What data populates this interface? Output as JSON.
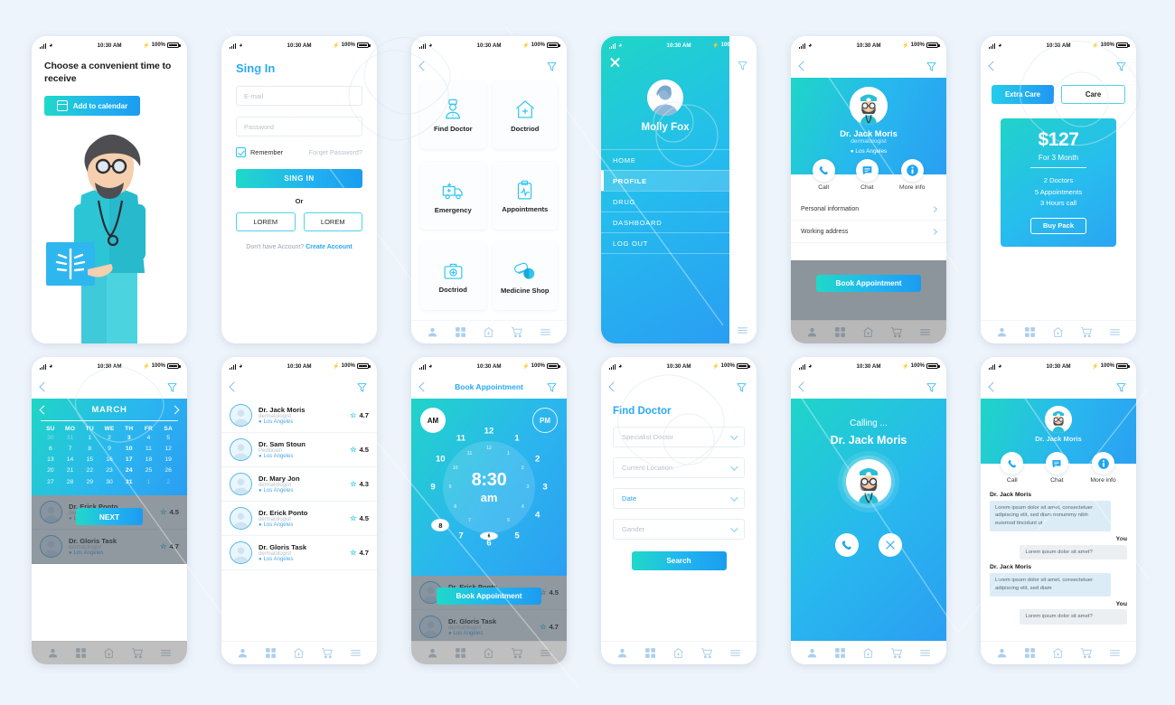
{
  "status_bar": {
    "time": "10:30 AM",
    "battery": "100%"
  },
  "tabbar": {
    "icons": [
      "person-icon",
      "grid-icon",
      "hospital-icon",
      "cart-icon",
      "menu-icon"
    ]
  },
  "screens": {
    "s1_calendar_intro": {
      "title": "Choose a convenient time to receive",
      "add_button": "Add to calendar",
      "icon": "calendar-icon",
      "illustration": "doctor-with-xray-illustration"
    },
    "s2_signin": {
      "title": "Sing In",
      "email_placeholder": "E-mail",
      "password_placeholder": "Password",
      "remember_label": "Remember",
      "forgot_label": "Forget Password?",
      "submit_label": "SING IN",
      "or_label": "Or",
      "social_left": "LOREM",
      "social_right": "LOREM",
      "no_account_text": "Don't have Account?",
      "create_account": "Create Account"
    },
    "s3_menu": {
      "items": [
        {
          "label": "Find Doctor",
          "icon": "doctor-icon"
        },
        {
          "label": "Doctriod",
          "icon": "hospital-home-icon"
        },
        {
          "label": "Emergency",
          "icon": "ambulance-icon"
        },
        {
          "label": "Appointments",
          "icon": "clipboard-pulse-icon"
        },
        {
          "label": "Doctriod",
          "icon": "first-aid-kit-icon"
        },
        {
          "label": "Medicine Shop",
          "icon": "pills-icon"
        }
      ]
    },
    "s4_drawer": {
      "user_name": "Molly Fox",
      "close_icon": "close-icon",
      "items": [
        "HOME",
        "PROFILE",
        "DRUG",
        "DASHBOARD",
        "LOG OUT"
      ],
      "active_item": "PROFILE"
    },
    "s5_profile": {
      "doctor_name": "Dr. Jack Moris",
      "specialty": "dermatologist",
      "location": "Los Angeles",
      "actions": [
        {
          "label": "Call",
          "icon": "phone-icon"
        },
        {
          "label": "Chat",
          "icon": "chat-icon"
        },
        {
          "label": "More info",
          "icon": "info-icon"
        }
      ],
      "rows": [
        "Personal information",
        "Working address"
      ],
      "cta": "Book Appointment"
    },
    "s6_pricing": {
      "tab_active": "Extra Care",
      "tab_inactive": "Care",
      "price": "$127",
      "period": "For 3 Month",
      "features": [
        "2 Doctors",
        "5 Appointments",
        "3 Hours call"
      ],
      "buy_label": "Buy Pack"
    },
    "s7_calendar": {
      "month": "MARCH",
      "dow": [
        "SU",
        "MO",
        "TU",
        "WE",
        "TH",
        "FR",
        "SA"
      ],
      "weeks": [
        [
          {
            "d": "30",
            "s": "mut"
          },
          {
            "d": "31",
            "s": "mut"
          },
          {
            "d": "1",
            "s": ""
          },
          {
            "d": "2",
            "s": ""
          },
          {
            "d": "3",
            "s": "hi"
          },
          {
            "d": "4",
            "s": ""
          },
          {
            "d": "5",
            "s": ""
          }
        ],
        [
          {
            "d": "6",
            "s": ""
          },
          {
            "d": "7",
            "s": ""
          },
          {
            "d": "8",
            "s": ""
          },
          {
            "d": "9",
            "s": ""
          },
          {
            "d": "10",
            "s": "hi"
          },
          {
            "d": "11",
            "s": ""
          },
          {
            "d": "12",
            "s": ""
          }
        ],
        [
          {
            "d": "13",
            "s": ""
          },
          {
            "d": "14",
            "s": ""
          },
          {
            "d": "15",
            "s": ""
          },
          {
            "d": "16",
            "s": ""
          },
          {
            "d": "17",
            "s": "hi"
          },
          {
            "d": "18",
            "s": ""
          },
          {
            "d": "19",
            "s": ""
          }
        ],
        [
          {
            "d": "20",
            "s": ""
          },
          {
            "d": "21",
            "s": ""
          },
          {
            "d": "22",
            "s": ""
          },
          {
            "d": "23",
            "s": ""
          },
          {
            "d": "24",
            "s": "hi"
          },
          {
            "d": "25",
            "s": ""
          },
          {
            "d": "26",
            "s": ""
          }
        ],
        [
          {
            "d": "27",
            "s": ""
          },
          {
            "d": "28",
            "s": ""
          },
          {
            "d": "29",
            "s": ""
          },
          {
            "d": "30",
            "s": ""
          },
          {
            "d": "31",
            "s": "hi"
          },
          {
            "d": "1",
            "s": "mut"
          },
          {
            "d": "2",
            "s": "mut"
          }
        ]
      ],
      "next_label": "NEXT",
      "doctors": [
        {
          "name": "Dr. Erick Ponto",
          "specialty": "dermatologist",
          "location": "Los Angeles",
          "rating": "4.5"
        },
        {
          "name": "Dr. Gloris Task",
          "specialty": "dermatologist",
          "location": "Los Angeles",
          "rating": "4.7"
        }
      ]
    },
    "s8_doctor_list": {
      "doctors": [
        {
          "name": "Dr. Jack Moris",
          "specialty": "dermatologist",
          "location": "Los Angeles",
          "rating": "4.7"
        },
        {
          "name": "Dr. Sam Stoun",
          "specialty": "Pediticain",
          "location": "Los Angeles",
          "rating": "4.5"
        },
        {
          "name": "Dr. Mary Jon",
          "specialty": "dermatologist",
          "location": "Los Angeles",
          "rating": "4.3"
        },
        {
          "name": "Dr. Erick Ponto",
          "specialty": "dermatologist",
          "location": "Los Angeles",
          "rating": "4.5"
        },
        {
          "name": "Dr. Gloris Task",
          "specialty": "dermatologist",
          "location": "Los Angeles",
          "rating": "4.7"
        }
      ]
    },
    "s9_time": {
      "title": "Book Appointment",
      "am_label": "AM",
      "pm_label": "PM",
      "time_value": "8:30",
      "meridiem": "am",
      "selected_hour": "8",
      "selected_minute": "6",
      "hours": [
        "12",
        "1",
        "2",
        "3",
        "4",
        "5",
        "6",
        "7",
        "8",
        "9",
        "10",
        "11"
      ],
      "minutes": [
        "12",
        "1",
        "2",
        "3",
        "4",
        "5",
        "6",
        "7",
        "8",
        "9",
        "10",
        "11"
      ],
      "cta": "Book Appointment",
      "doctors": [
        {
          "name": "Dr. Erick Ponto",
          "specialty": "dermatologist",
          "location": "Los Angeles",
          "rating": "4.5"
        },
        {
          "name": "Dr. Gloris Task",
          "specialty": "dermatologist",
          "location": "Los Angeles",
          "rating": "4.7"
        }
      ]
    },
    "s10_find": {
      "title": "Find Doctor",
      "fields": [
        {
          "label": "Specialist Doctor",
          "accent": false
        },
        {
          "label": "Current Location",
          "accent": false
        },
        {
          "label": "Date",
          "accent": true
        },
        {
          "label": "Gander",
          "accent": false
        }
      ],
      "search_label": "Search"
    },
    "s11_calling": {
      "status": "Calling ...",
      "doctor_name": "Dr. Jack Moris",
      "accept_icon": "phone-icon",
      "decline_icon": "close-icon"
    },
    "s12_chat": {
      "doctor_name": "Dr. Jack Moris",
      "actions": [
        {
          "label": "Call",
          "icon": "phone-icon"
        },
        {
          "label": "Chat",
          "icon": "chat-icon"
        },
        {
          "label": "More info",
          "icon": "info-icon"
        }
      ],
      "messages": [
        {
          "who": "Dr. Jack Moris",
          "side": "them",
          "text": "Lorem ipsum dolor sit amet, consectetuer adipiscing elit, sed diam nonummy nibh euismod tincidunt ut"
        },
        {
          "who": "You",
          "side": "me",
          "text": "Lorem ipsum dolor sit amet?"
        },
        {
          "who": "Dr. Jack Moris",
          "side": "them",
          "text": "Lorem ipsum dolor sit amet, consectetuer adipiscing elit, sed diam"
        },
        {
          "who": "You",
          "side": "me",
          "text": "Lorem ipsum dolor sit amet?"
        }
      ]
    }
  },
  "colors": {
    "page_bg": "#eef4fb",
    "accent_cyan": "#29c6e8",
    "accent_blue": "#29a9f3",
    "gradient_start": "#1fd9c8",
    "gradient_end": "#1b9cf0",
    "dim_overlay": "rgba(70,84,96,0.62)"
  }
}
